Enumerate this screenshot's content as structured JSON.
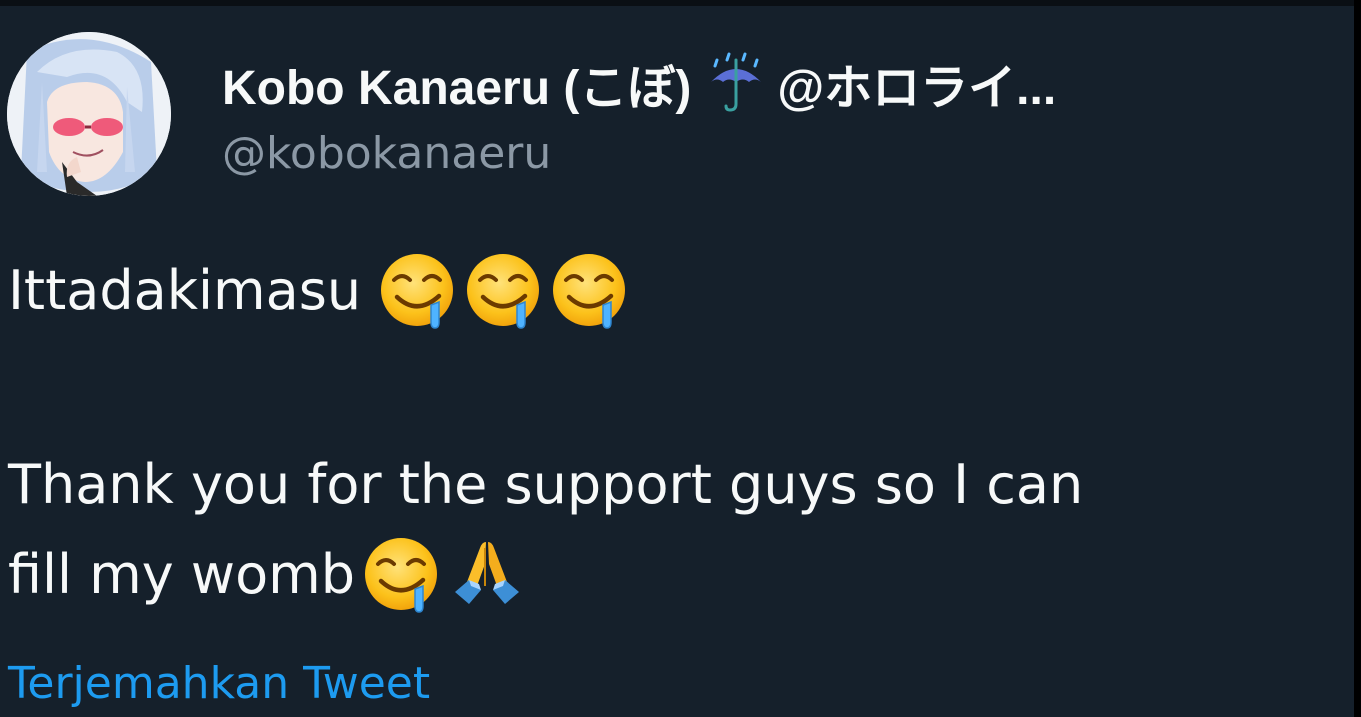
{
  "author": {
    "display_name": "Kobo Kanaeru (こぼ)",
    "affiliation": "@ホロライ...",
    "handle": "@kobokanaeru",
    "avatar_icon": "avatar-anime-girl-pink-glasses",
    "badge_icon": "umbrella-with-rain-icon"
  },
  "tweet": {
    "line1": "Ittadakimasu",
    "line1_emojis": [
      "drooling-face-emoji",
      "drooling-face-emoji",
      "drooling-face-emoji"
    ],
    "line2": "Thank you for the support guys so I can",
    "line3": "fill my womb",
    "line3_emojis": [
      "drooling-face-emoji",
      "folded-hands-emoji"
    ]
  },
  "translate_link": "Terjemahkan Tweet",
  "colors": {
    "background": "#15202b",
    "text": "#f7f9f9",
    "secondary": "#8b98a5",
    "link": "#1d9bf0"
  }
}
